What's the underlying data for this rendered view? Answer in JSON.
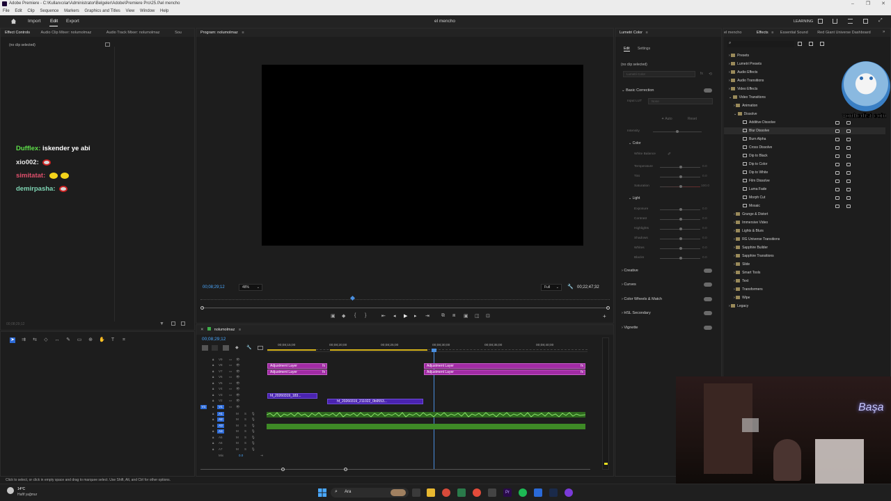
{
  "window": {
    "title": "Adobe Premiere - C:\\Kullanıcılar\\Administrator\\Belgeler\\Adobe\\Premiere Pro\\25.0\\el mencho",
    "controls": [
      "–",
      "❐",
      "✕"
    ]
  },
  "menubar": [
    "File",
    "Edit",
    "Clip",
    "Sequence",
    "Markers",
    "Graphics and Titles",
    "View",
    "Window",
    "Help"
  ],
  "topbar": {
    "nav": [
      "Import",
      "Edit",
      "Export"
    ],
    "active_nav": "Edit",
    "project_name": "el mencho",
    "workspace": "LEARNING"
  },
  "left_panel": {
    "tabs": [
      "Effect Controls",
      "Audio Clip Mixer: nolumolmaz",
      "Audio Track Mixer: nolumolmaz",
      "Sou"
    ],
    "no_clip": "(no clip selected)",
    "timecode": "00;08;29;12"
  },
  "chat": [
    {
      "user": "Dufflex:",
      "message": "iskender ye abi",
      "color": "#5ee04a"
    },
    {
      "user": "xio002:",
      "message": "",
      "color": "#e8e8e8"
    },
    {
      "user": "simitatat:",
      "message": "",
      "color": "#e0506c"
    },
    {
      "user": "demirpasha:",
      "message": "",
      "color": "#7fd6b4"
    }
  ],
  "program_monitor": {
    "tab": "Program: nolumolmaz",
    "timecode": "00;08;29;12",
    "zoom": "48%",
    "quality": "Full",
    "duration": "00;22;47;32"
  },
  "timeline": {
    "tab": "nolumolmaz",
    "timecode": "00;08;29;12",
    "ruler": [
      "00;08;15;00",
      "00;08;20;00",
      "00;08;25;00",
      "00;08;30;00",
      "00;08;35;00",
      "00;08;40;00"
    ],
    "video_tracks": [
      "V9",
      "V8",
      "V7",
      "V6",
      "V5",
      "V4",
      "V3",
      "V2",
      "V1"
    ],
    "audio_tracks": [
      "A1",
      "A2",
      "A3",
      "A4",
      "A5",
      "A6",
      "A7"
    ],
    "mix_label": "Mix",
    "mix_value": "0.0",
    "clips": {
      "adj_1": "Adjustment Layer",
      "adj_2": "Adjustment Layer",
      "adj_3": "Adjustment Layer",
      "adj_4": "Adjustment Layer",
      "vid_1": "hf_20260319_183...",
      "vid_2": "hf_20260319_211022_0b9553..."
    }
  },
  "lumetri": {
    "tab": "Lumetri Color",
    "subtabs": [
      "Edit",
      "Settings"
    ],
    "no_clip": "(no clip selected)",
    "preset": "Lumetri Color",
    "sections": {
      "basic": "Basic Correction",
      "input_lut_label": "Input LUT",
      "input_lut_value": "None",
      "auto": "Auto",
      "reset": "Reset",
      "intensity": "Intensity",
      "color": "Color",
      "white_balance": "White Balance",
      "color_params": [
        "Temperature",
        "Tint",
        "Saturation"
      ],
      "color_values": [
        "0.0",
        "0.0",
        "100.0"
      ],
      "light": "Light",
      "light_params": [
        "Exposure",
        "Contrast",
        "Highlights",
        "Shadows",
        "Whites",
        "Blacks"
      ],
      "light_values": [
        "0.0",
        "0.0",
        "0.0",
        "0.0",
        "0.0",
        "0.0"
      ],
      "collapsed": [
        "Creative",
        "Curves",
        "Color Wheels & Match",
        "HSL Secondary",
        "Vignette"
      ]
    }
  },
  "effects_panel": {
    "tabs": [
      "el mencho",
      "Effects",
      "Essential Sound",
      "Red Giant Universe Dashboard"
    ],
    "active_tab": "Effects",
    "tree_top": [
      "Presets",
      "Lumetri Presets",
      "Audio Effects",
      "Audio Transitions",
      "Video Effects",
      "Video Transitions"
    ],
    "tree_vt": [
      "Animation",
      "Dissolve"
    ],
    "dissolve_items": [
      "Additive Dissolve",
      "Blur Dissolve",
      "Burn Alpha",
      "Cross Dissolve",
      "Dip to Black",
      "Dip to Color",
      "Dip to White",
      "Film Dissolve",
      "Luma Fade",
      "Morph Cut",
      "Mosaic"
    ],
    "tree_bottom": [
      "Grunge & Distort",
      "Immersive Video",
      "Lights & Blurs",
      "RG Universe Transitions",
      "Sapphire Builder",
      "Sapphire Transitions",
      "Slide",
      "Smart Tools",
      "Text",
      "Transformers",
      "Wipe"
    ],
    "legacy": "Legacy"
  },
  "overlay": {
    "cat_caption": "vonhedist eoin",
    "webcam_text": "Başa"
  },
  "statusbar": {
    "hint": "Click to select, or click in empty space and drag to marquee select. Use Shift, Alt, and Ctrl for other options."
  },
  "taskbar": {
    "weather_temp": "14°C",
    "weather_desc": "Hafif yağmur",
    "search": "Ara"
  }
}
